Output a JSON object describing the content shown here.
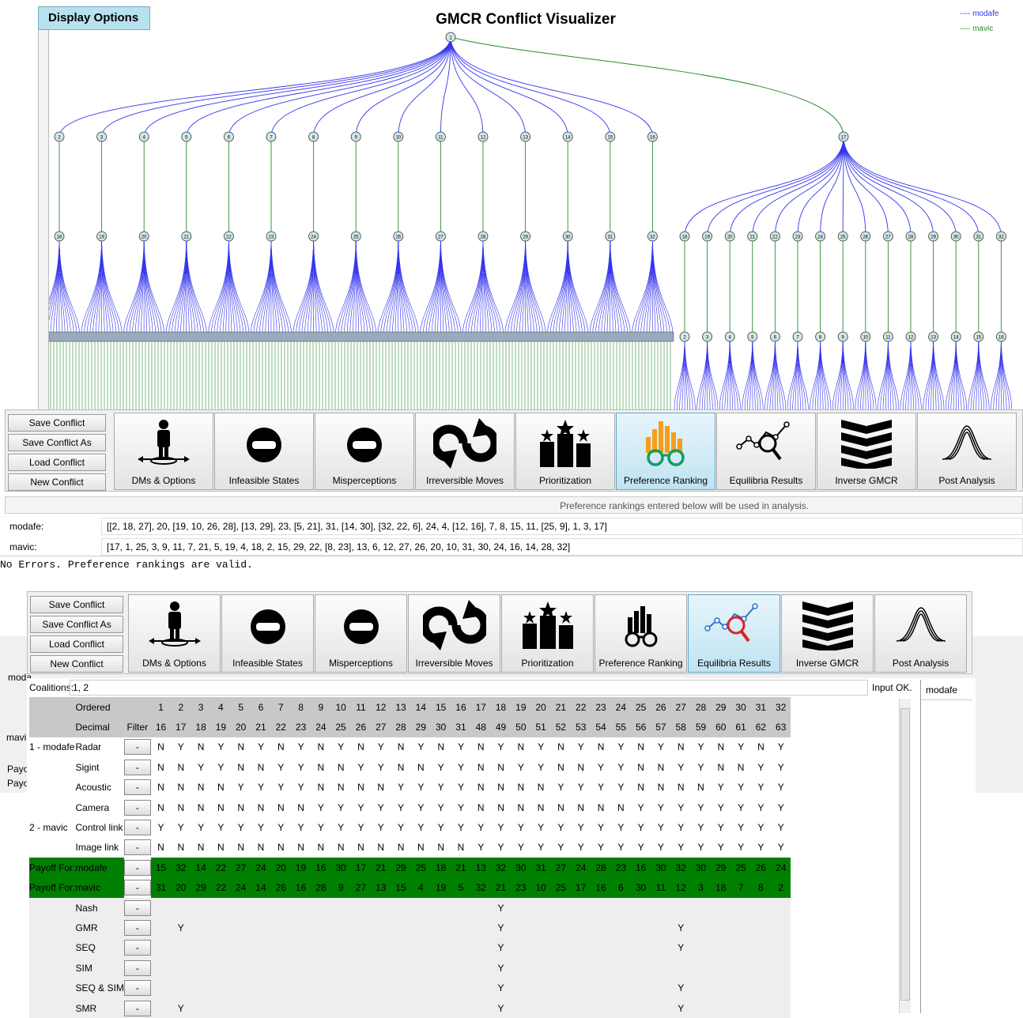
{
  "visualizer": {
    "display_options_label": "Display Options",
    "title": "GMCR Conflict Visualizer",
    "legend": [
      "---- modafe",
      "---- mavic"
    ],
    "root_node": "1",
    "level1_left": [
      "2",
      "3",
      "4",
      "5",
      "6",
      "7",
      "8",
      "9",
      "10",
      "11",
      "12",
      "13",
      "14",
      "15",
      "16"
    ],
    "level2_left": [
      "18",
      "19",
      "20",
      "21",
      "22",
      "23",
      "24",
      "25",
      "26",
      "27",
      "28",
      "29",
      "30",
      "31",
      "32"
    ],
    "node_17": "17",
    "right_level1": [
      "18",
      "19",
      "20",
      "21",
      "22",
      "23",
      "24",
      "25",
      "26",
      "27",
      "28",
      "29",
      "30",
      "31",
      "32"
    ],
    "right_level2": [
      "2",
      "3",
      "4",
      "5",
      "6",
      "7",
      "8",
      "9",
      "10",
      "11",
      "12",
      "13",
      "14",
      "15",
      "16"
    ],
    "colors": {
      "modafe": "#3333ee",
      "mavic": "#2a8a2a"
    }
  },
  "toolbar1": {
    "side_buttons": [
      "Save Conflict",
      "Save Conflict As",
      "Load Conflict",
      "New Conflict"
    ],
    "tabs": [
      {
        "label": "DMs & Options",
        "icon": "person-arrows-icon"
      },
      {
        "label": "Infeasible States",
        "icon": "no-entry-icon"
      },
      {
        "label": "Misperceptions",
        "icon": "no-entry-icon"
      },
      {
        "label": "Irreversible Moves",
        "icon": "reverse-arrows-icon"
      },
      {
        "label": "Prioritization",
        "icon": "podium-stars-icon"
      },
      {
        "label": "Preference Ranking",
        "icon": "bar-glasses-icon"
      },
      {
        "label": "Equilibria Results",
        "icon": "magnifier-graph-icon"
      },
      {
        "label": "Inverse GMCR",
        "icon": "chevrons-icon"
      },
      {
        "label": "Post Analysis",
        "icon": "wave-icon"
      }
    ],
    "active": "Preference Ranking"
  },
  "preference": {
    "info": "Preference rankings entered below will be used in analysis.",
    "rows": [
      {
        "dm": "modafe:",
        "value": "[[2, 18, 27], 20, [19, 10, 26, 28], [13, 29], 23, [5, 21], 31, [14, 30], [32, 22, 6], 24, 4, [12, 16], 7, 8, 15, 11, [25, 9], 1, 3, 17]"
      },
      {
        "dm": "mavic:",
        "value": "[17, 1, 25, 3, 9, 11, 7, 21, 5, 19, 4, 18, 2, 15, 29, 22, [8, 23], 13, 6, 12, 27, 26, 20, 10, 31, 30, 24, 16, 14, 28, 32]"
      }
    ],
    "status": "No Errors. Preference rankings are valid."
  },
  "toolbar2": {
    "active": "Equilibria Results"
  },
  "background_fragments": {
    "moda": "moda",
    "mavi": "mavi",
    "payo1": "Payo",
    "payo2": "Payo"
  },
  "equilibria": {
    "coalitions_label": "Coalitions:",
    "coalitions_value": "1, 2",
    "input_status": "Input OK.",
    "side_list_item": "modafe",
    "header_ordered": "Ordered",
    "header_decimal": "Decimal",
    "filter_label": "Filter",
    "filter_button": "-",
    "ordered": [
      "1",
      "2",
      "3",
      "4",
      "5",
      "6",
      "7",
      "8",
      "9",
      "10",
      "11",
      "12",
      "13",
      "14",
      "15",
      "16",
      "17",
      "18",
      "19",
      "20",
      "21",
      "22",
      "23",
      "24",
      "25",
      "26",
      "27",
      "28",
      "29",
      "30",
      "31",
      "32"
    ],
    "decimal": [
      "16",
      "17",
      "18",
      "19",
      "20",
      "21",
      "22",
      "23",
      "24",
      "25",
      "26",
      "27",
      "28",
      "29",
      "30",
      "31",
      "48",
      "49",
      "50",
      "51",
      "52",
      "53",
      "54",
      "55",
      "56",
      "57",
      "58",
      "59",
      "60",
      "61",
      "62",
      "63"
    ],
    "option_rows": [
      {
        "dm": "1 - modafe",
        "option": "Radar",
        "values": [
          "N",
          "Y",
          "N",
          "Y",
          "N",
          "Y",
          "N",
          "Y",
          "N",
          "Y",
          "N",
          "Y",
          "N",
          "Y",
          "N",
          "Y",
          "N",
          "Y",
          "N",
          "Y",
          "N",
          "Y",
          "N",
          "Y",
          "N",
          "Y",
          "N",
          "Y",
          "N",
          "Y",
          "N",
          "Y"
        ]
      },
      {
        "dm": "",
        "option": "Sigint",
        "values": [
          "N",
          "N",
          "Y",
          "Y",
          "N",
          "N",
          "Y",
          "Y",
          "N",
          "N",
          "Y",
          "Y",
          "N",
          "N",
          "Y",
          "Y",
          "N",
          "N",
          "Y",
          "Y",
          "N",
          "N",
          "Y",
          "Y",
          "N",
          "N",
          "Y",
          "Y",
          "N",
          "N",
          "Y",
          "Y"
        ]
      },
      {
        "dm": "",
        "option": "Acoustic",
        "values": [
          "N",
          "N",
          "N",
          "N",
          "Y",
          "Y",
          "Y",
          "Y",
          "N",
          "N",
          "N",
          "N",
          "Y",
          "Y",
          "Y",
          "Y",
          "N",
          "N",
          "N",
          "N",
          "Y",
          "Y",
          "Y",
          "Y",
          "N",
          "N",
          "N",
          "N",
          "Y",
          "Y",
          "Y",
          "Y"
        ]
      },
      {
        "dm": "",
        "option": "Camera",
        "values": [
          "N",
          "N",
          "N",
          "N",
          "N",
          "N",
          "N",
          "N",
          "Y",
          "Y",
          "Y",
          "Y",
          "Y",
          "Y",
          "Y",
          "Y",
          "N",
          "N",
          "N",
          "N",
          "N",
          "N",
          "N",
          "N",
          "Y",
          "Y",
          "Y",
          "Y",
          "Y",
          "Y",
          "Y",
          "Y"
        ]
      },
      {
        "dm": "2 - mavic",
        "option": "Control link",
        "values": [
          "Y",
          "Y",
          "Y",
          "Y",
          "Y",
          "Y",
          "Y",
          "Y",
          "Y",
          "Y",
          "Y",
          "Y",
          "Y",
          "Y",
          "Y",
          "Y",
          "Y",
          "Y",
          "Y",
          "Y",
          "Y",
          "Y",
          "Y",
          "Y",
          "Y",
          "Y",
          "Y",
          "Y",
          "Y",
          "Y",
          "Y",
          "Y"
        ]
      },
      {
        "dm": "",
        "option": "Image link",
        "values": [
          "N",
          "N",
          "N",
          "N",
          "N",
          "N",
          "N",
          "N",
          "N",
          "N",
          "N",
          "N",
          "N",
          "N",
          "N",
          "N",
          "Y",
          "Y",
          "Y",
          "Y",
          "Y",
          "Y",
          "Y",
          "Y",
          "Y",
          "Y",
          "Y",
          "Y",
          "Y",
          "Y",
          "Y",
          "Y"
        ]
      }
    ],
    "payoff_rows": [
      {
        "label": "Payoff For:",
        "dm": "modafe",
        "values": [
          "15",
          "32",
          "14",
          "22",
          "27",
          "24",
          "20",
          "19",
          "16",
          "30",
          "17",
          "21",
          "29",
          "25",
          "18",
          "21",
          "13",
          "32",
          "30",
          "31",
          "27",
          "24",
          "28",
          "23",
          "16",
          "30",
          "32",
          "30",
          "29",
          "25",
          "26",
          "24"
        ]
      },
      {
        "label": "Payoff For:",
        "dm": "mavic",
        "values": [
          "31",
          "20",
          "29",
          "22",
          "24",
          "14",
          "26",
          "16",
          "28",
          "9",
          "27",
          "13",
          "15",
          "4",
          "19",
          "5",
          "32",
          "21",
          "23",
          "10",
          "25",
          "17",
          "16",
          "6",
          "30",
          "11",
          "12",
          "3",
          "18",
          "7",
          "8",
          "2"
        ]
      }
    ],
    "eq_rows": [
      {
        "name": "Nash",
        "values": [
          "",
          "",
          "",
          "",
          "",
          "",
          "",
          "",
          "",
          "",
          "",
          "",
          "",
          "",
          "",
          "",
          "",
          "Y",
          "",
          "",
          "",
          "",
          "",
          "",
          "",
          "",
          "",
          "",
          "",
          "",
          "",
          ""
        ]
      },
      {
        "name": "GMR",
        "values": [
          "",
          "Y",
          "",
          "",
          "",
          "",
          "",
          "",
          "",
          "",
          "",
          "",
          "",
          "",
          "",
          "",
          "",
          "Y",
          "",
          "",
          "",
          "",
          "",
          "",
          "",
          "",
          "Y",
          "",
          "",
          "",
          "",
          ""
        ]
      },
      {
        "name": "SEQ",
        "values": [
          "",
          "",
          "",
          "",
          "",
          "",
          "",
          "",
          "",
          "",
          "",
          "",
          "",
          "",
          "",
          "",
          "",
          "Y",
          "",
          "",
          "",
          "",
          "",
          "",
          "",
          "",
          "Y",
          "",
          "",
          "",
          "",
          ""
        ]
      },
      {
        "name": "SIM",
        "values": [
          "",
          "",
          "",
          "",
          "",
          "",
          "",
          "",
          "",
          "",
          "",
          "",
          "",
          "",
          "",
          "",
          "",
          "Y",
          "",
          "",
          "",
          "",
          "",
          "",
          "",
          "",
          "",
          "",
          "",
          "",
          "",
          ""
        ]
      },
      {
        "name": "SEQ & SIM",
        "values": [
          "",
          "",
          "",
          "",
          "",
          "",
          "",
          "",
          "",
          "",
          "",
          "",
          "",
          "",
          "",
          "",
          "",
          "Y",
          "",
          "",
          "",
          "",
          "",
          "",
          "",
          "",
          "Y",
          "",
          "",
          "",
          "",
          ""
        ]
      },
      {
        "name": "SMR",
        "values": [
          "",
          "Y",
          "",
          "",
          "",
          "",
          "",
          "",
          "",
          "",
          "",
          "",
          "",
          "",
          "",
          "",
          "",
          "Y",
          "",
          "",
          "",
          "",
          "",
          "",
          "",
          "",
          "Y",
          "",
          "",
          "",
          "",
          ""
        ]
      }
    ]
  }
}
